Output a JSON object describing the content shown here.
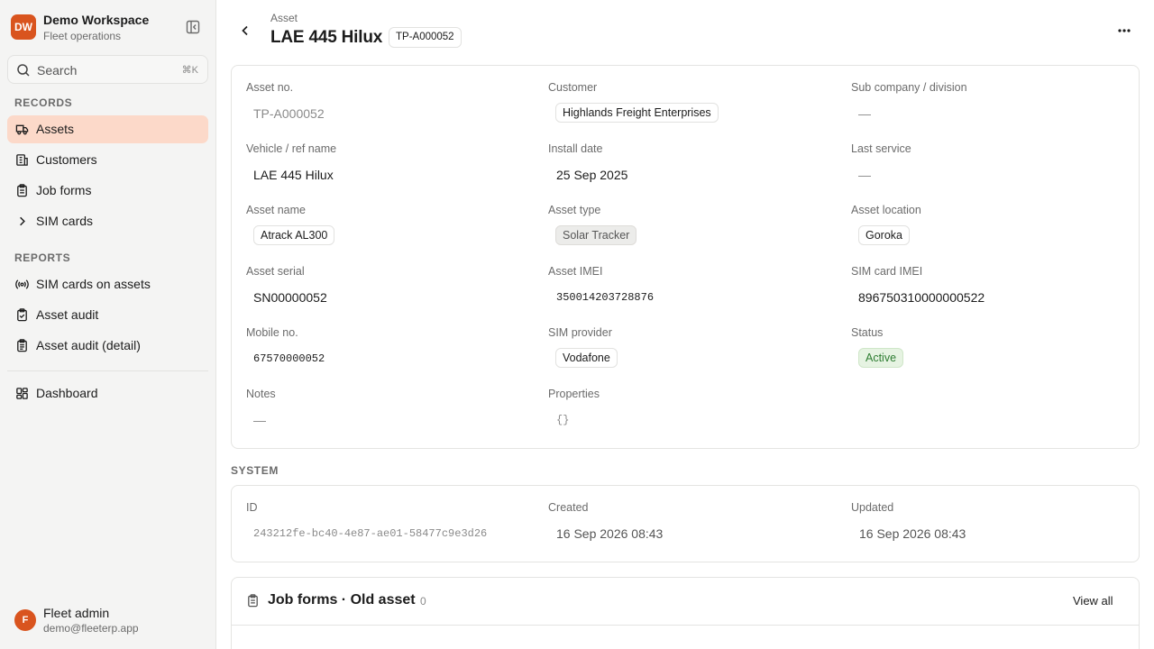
{
  "workspace": {
    "initials": "DW",
    "name": "Demo Workspace",
    "subtitle": "Fleet operations"
  },
  "search": {
    "label": "Search",
    "shortcut": "⌘K"
  },
  "sidebar": {
    "records_heading": "RECORDS",
    "records": [
      {
        "label": "Assets",
        "icon": "truck-icon",
        "active": true
      },
      {
        "label": "Customers",
        "icon": "building-icon"
      },
      {
        "label": "Job forms",
        "icon": "clipboard-icon"
      },
      {
        "label": "SIM cards",
        "icon": "chevron-right-icon"
      }
    ],
    "reports_heading": "REPORTS",
    "reports": [
      {
        "label": "SIM cards on assets",
        "icon": "radio-signal-icon"
      },
      {
        "label": "Asset audit",
        "icon": "clipboard-check-icon"
      },
      {
        "label": "Asset audit (detail)",
        "icon": "clipboard-list-icon"
      }
    ],
    "dashboard": {
      "label": "Dashboard",
      "icon": "dashboard-icon"
    }
  },
  "user": {
    "initial": "F",
    "name": "Fleet admin",
    "email": "demo@fleeterp.app"
  },
  "header": {
    "breadcrumb": "Asset",
    "title": "LAE 445 Hilux",
    "code": "TP-A000052"
  },
  "details": {
    "asset_no": {
      "label": "Asset no.",
      "value": "TP-A000052"
    },
    "customer": {
      "label": "Customer",
      "value": "Highlands Freight Enterprises"
    },
    "sub_company": {
      "label": "Sub company / division",
      "value": "—"
    },
    "vehicle": {
      "label": "Vehicle / ref name",
      "value": "LAE 445 Hilux"
    },
    "install_date": {
      "label": "Install date",
      "value": "25 Sep 2025"
    },
    "last_service": {
      "label": "Last service",
      "value": "—"
    },
    "asset_name": {
      "label": "Asset name",
      "value": "Atrack AL300"
    },
    "asset_type": {
      "label": "Asset type",
      "value": "Solar Tracker"
    },
    "asset_location": {
      "label": "Asset location",
      "value": "Goroka"
    },
    "asset_serial": {
      "label": "Asset serial",
      "value": "SN00000052"
    },
    "asset_imei": {
      "label": "Asset IMEI",
      "value": "350014203728876"
    },
    "sim_imei": {
      "label": "SIM card IMEI",
      "value": "896750310000000522"
    },
    "mobile_no": {
      "label": "Mobile no.",
      "value": "67570000052"
    },
    "sim_provider": {
      "label": "SIM provider",
      "value": "Vodafone"
    },
    "status": {
      "label": "Status",
      "value": "Active",
      "color": "#2e7d32"
    },
    "notes": {
      "label": "Notes",
      "value": "—"
    },
    "properties": {
      "label": "Properties",
      "value": "{}"
    }
  },
  "system": {
    "heading": "SYSTEM",
    "id": {
      "label": "ID",
      "value": "243212fe-bc40-4e87-ae01-58477c9e3d26"
    },
    "created": {
      "label": "Created",
      "value": "16 Sep 2026 08:43"
    },
    "updated": {
      "label": "Updated",
      "value": "16 Sep 2026 08:43"
    }
  },
  "job_forms": {
    "title": "Job forms · Old asset",
    "count": "0",
    "view_all": "View all"
  },
  "colors": {
    "accent": "#d9541e",
    "active_nav": "#fcd9c9"
  }
}
